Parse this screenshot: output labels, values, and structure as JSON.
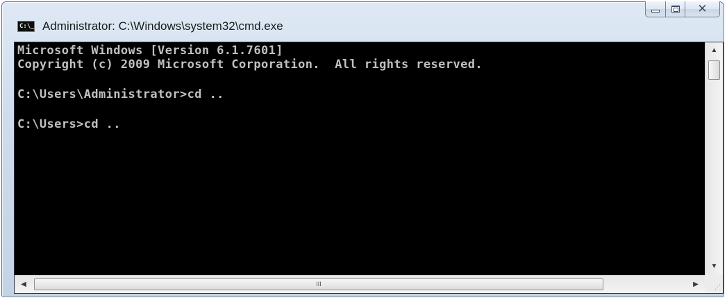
{
  "window": {
    "title": "Administrator: C:\\Windows\\system32\\cmd.exe",
    "icon_text": "C:\\_",
    "icon": "console-icon"
  },
  "caption_buttons": {
    "minimize_icon": "minimize-icon",
    "maximize_icon": "maximize-icon",
    "close_icon": "close-icon",
    "close_glyph": "✕"
  },
  "console": {
    "foreground": "#c0c0c0",
    "background": "#000000",
    "lines": [
      "Microsoft Windows [Version 6.1.7601]",
      "Copyright (c) 2009 Microsoft Corporation.  All rights reserved.",
      "",
      "C:\\Users\\Administrator>cd ..",
      "",
      "C:\\Users>cd .."
    ]
  },
  "scrollbars": {
    "up_arrow": "▲",
    "down_arrow": "▼",
    "left_arrow": "◀",
    "right_arrow": "▶",
    "thumb_grip": "III",
    "size_grip": "⋰"
  }
}
